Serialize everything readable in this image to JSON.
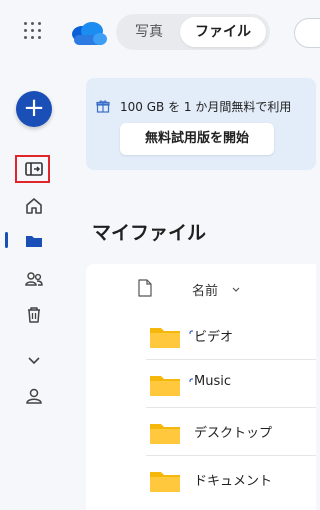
{
  "header": {
    "toggle": {
      "photos_label": "写真",
      "files_label": "ファイル"
    }
  },
  "promo": {
    "text": "100 GB を 1 か月間無料で利用",
    "button_label": "無料試用版を開始"
  },
  "page_title": "マイファイル",
  "list": {
    "name_header": "名前",
    "rows": [
      {
        "name": "ビデオ",
        "new_indicator": true
      },
      {
        "name": "Music",
        "new_indicator": true
      },
      {
        "name": "デスクトップ",
        "new_indicator": false
      },
      {
        "name": "ドキュメント",
        "new_indicator": false
      }
    ]
  },
  "colors": {
    "accent": "#1a4fb8",
    "highlight": "#e0262b",
    "folder": "#f5b70a",
    "promo_bg": "#e3edf9"
  },
  "icons": [
    "app-launcher-icon",
    "onedrive-logo-icon",
    "collapse-pane-icon",
    "home-icon",
    "folder-icon",
    "shared-icon",
    "recycle-bin-icon",
    "chevron-down-icon",
    "profile-icon",
    "gift-icon",
    "document-icon"
  ]
}
